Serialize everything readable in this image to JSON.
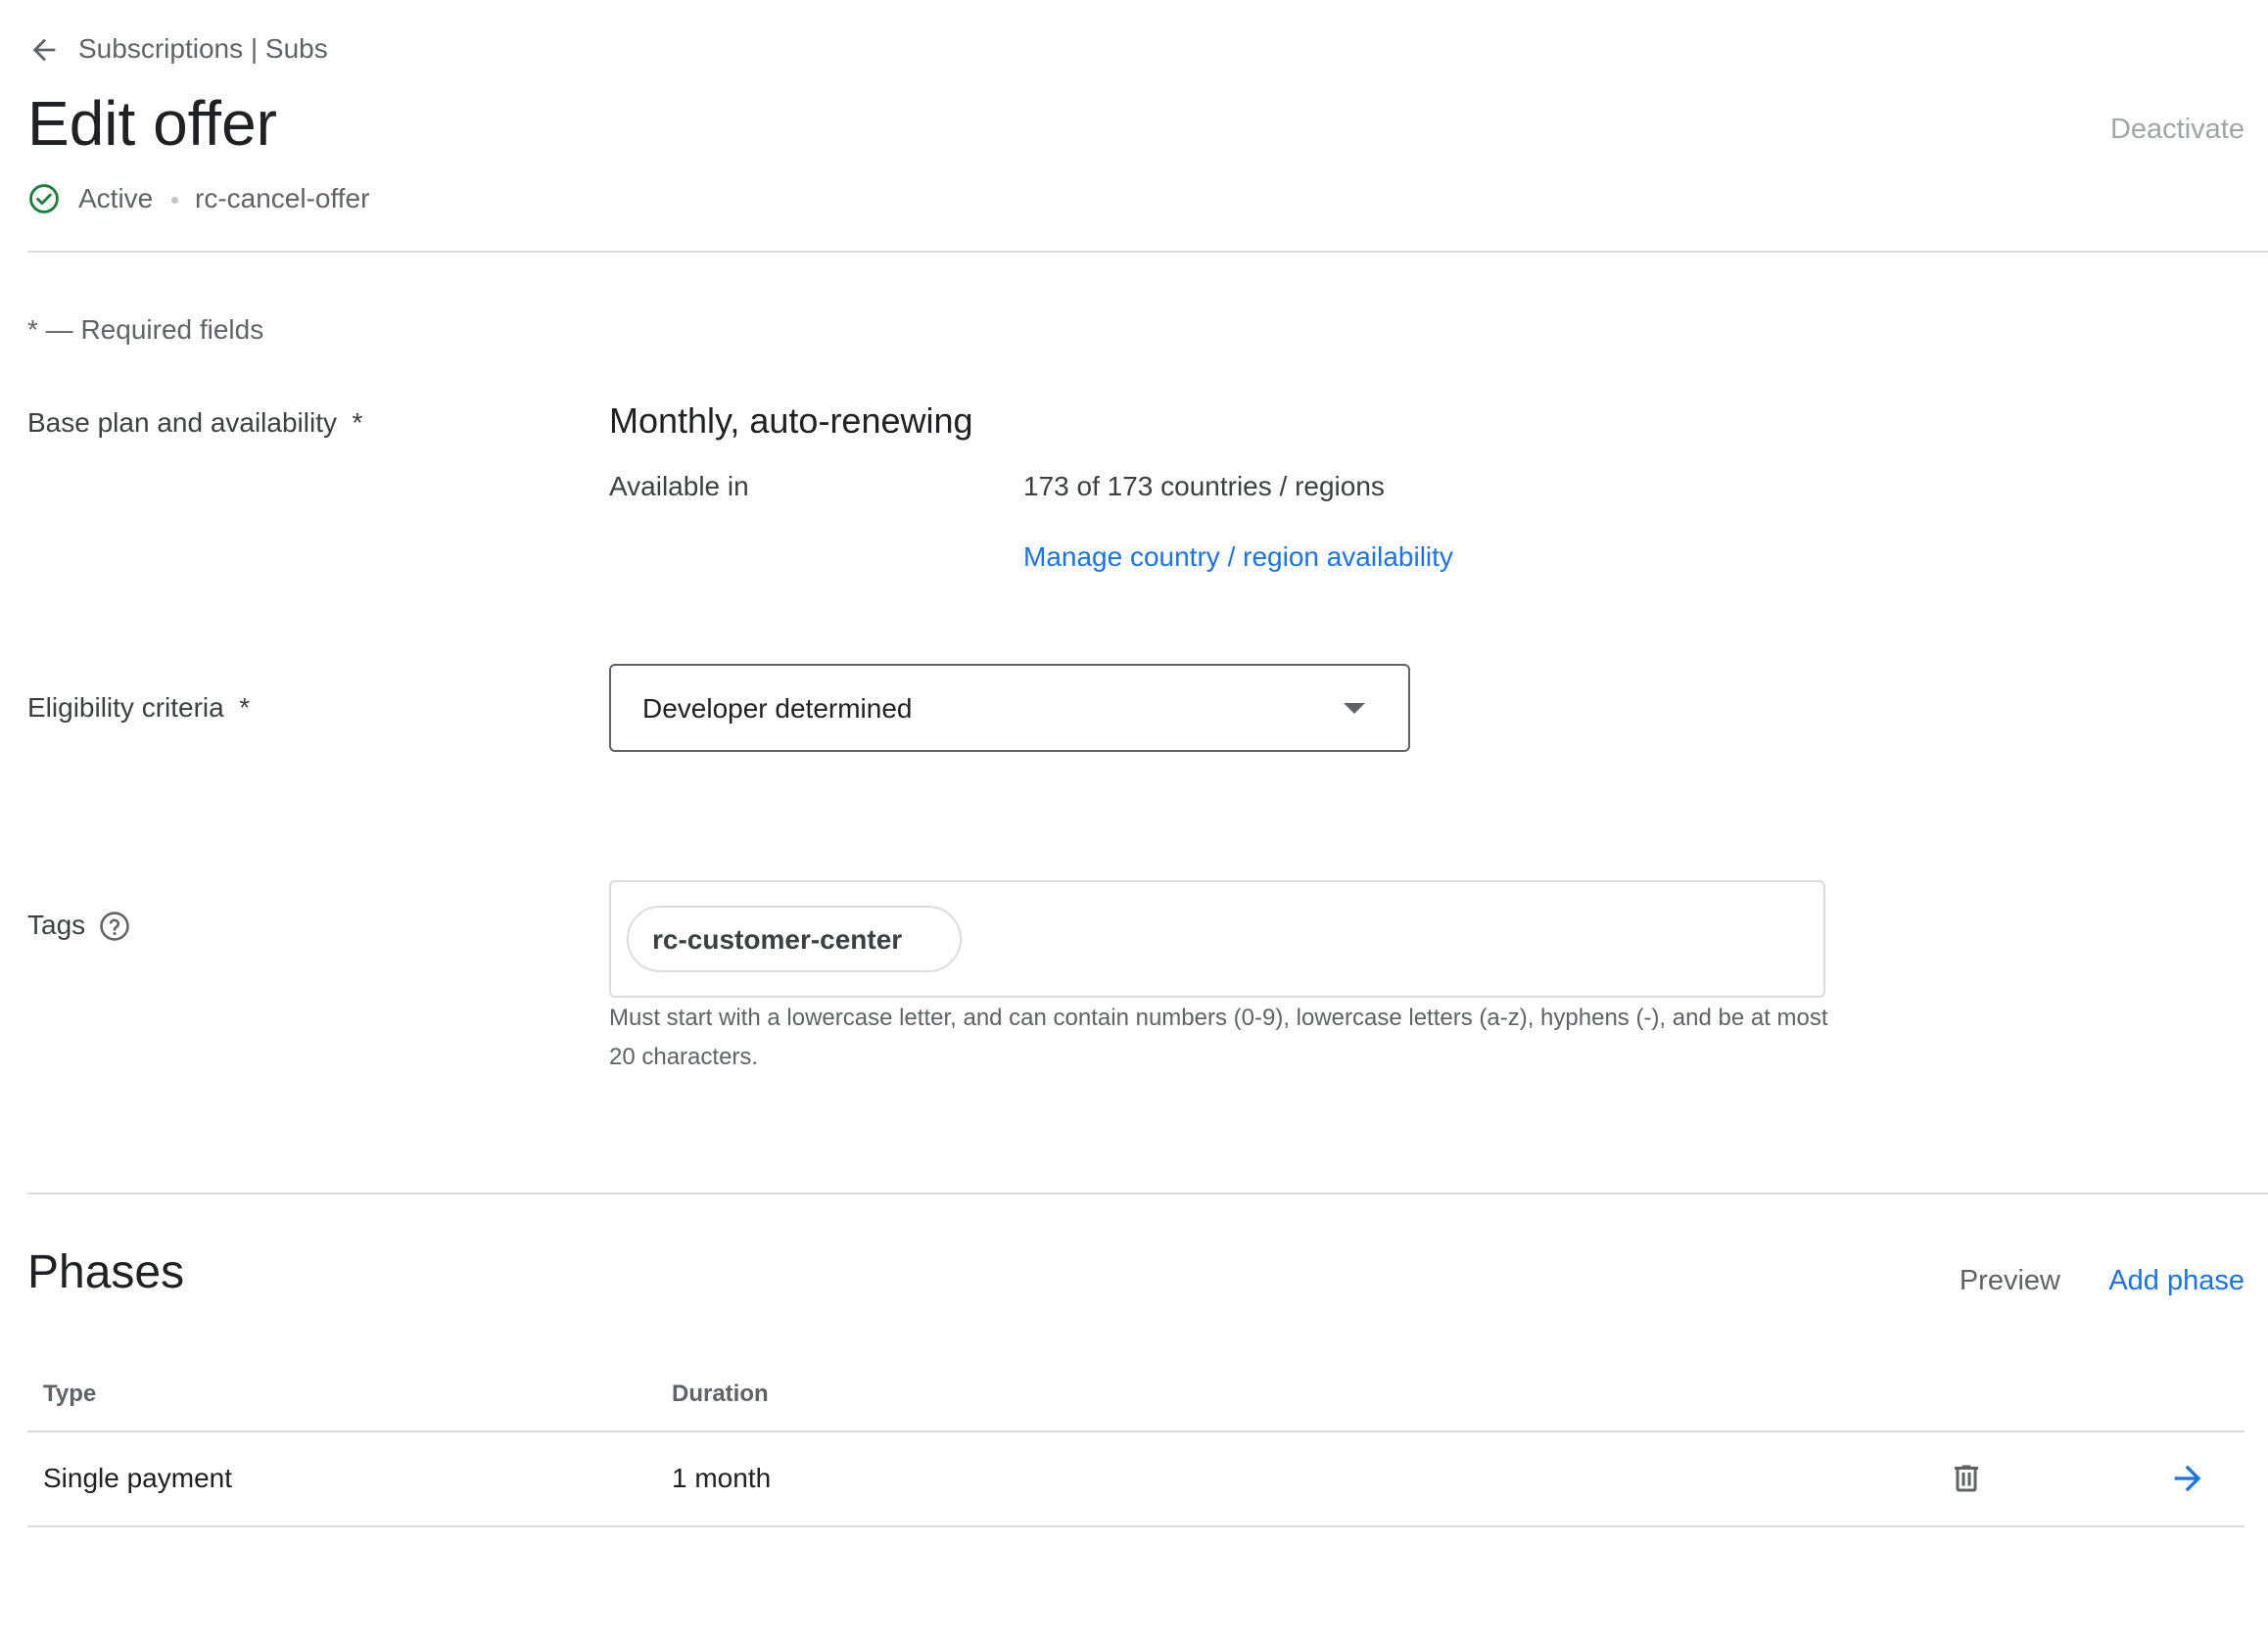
{
  "header": {
    "back_icon": "arrow-back-icon",
    "breadcrumb": "Subscriptions | Subs",
    "title": "Edit offer",
    "deactivate_label": "Deactivate",
    "status_icon": "check-circle-icon",
    "status": "Active",
    "offer_id": "rc-cancel-offer"
  },
  "form": {
    "required_note": "* — Required fields",
    "base_plan": {
      "label": "Base plan and availability  *",
      "name": "Monthly, auto-renewing",
      "available_label": "Available in",
      "available_value": "173 of 173 countries / regions",
      "manage_link": "Manage country / region availability"
    },
    "eligibility": {
      "label": "Eligibility criteria  *",
      "selected": "Developer determined"
    },
    "tags": {
      "label": "Tags",
      "help_icon": "help-circle-icon",
      "chips": [
        "rc-customer-center"
      ],
      "helper_text": "Must start with a lowercase letter, and can contain numbers (0-9), lowercase letters (a-z), hyphens (-), and be at most 20 characters."
    }
  },
  "phases": {
    "title": "Phases",
    "preview_label": "Preview",
    "add_phase_label": "Add phase",
    "columns": [
      "Type",
      "Duration"
    ],
    "rows": [
      {
        "type": "Single payment",
        "duration": "1 month",
        "delete_icon": "trash-icon",
        "open_icon": "arrow-forward-icon"
      }
    ]
  },
  "colors": {
    "accent": "#1a73e8",
    "status_green": "#188038",
    "text": "#202124",
    "muted": "#5f6368",
    "divider": "#dadce0"
  }
}
